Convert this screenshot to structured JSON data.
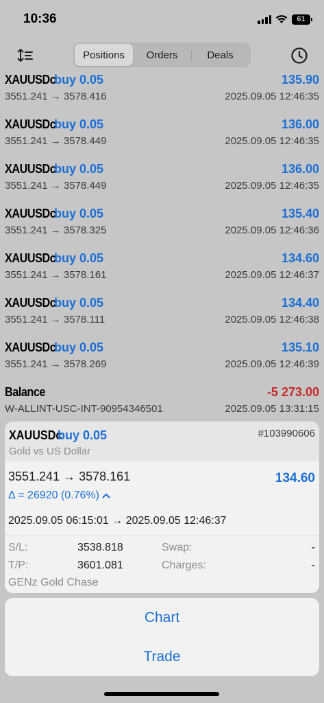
{
  "status": {
    "time": "10:36",
    "battery": "61"
  },
  "tabs": [
    "Positions",
    "Orders",
    "Deals"
  ],
  "active_tab": 0,
  "positions": [
    {
      "symbol": "XAUUSDc",
      "type": "buy 0.05",
      "profit": "135.90",
      "prices": "3551.241 → 3578.416",
      "time": "2025.09.05 12:46:35"
    },
    {
      "symbol": "XAUUSDc",
      "type": "buy 0.05",
      "profit": "136.00",
      "prices": "3551.241 → 3578.449",
      "time": "2025.09.05 12:46:35"
    },
    {
      "symbol": "XAUUSDc",
      "type": "buy 0.05",
      "profit": "136.00",
      "prices": "3551.241 → 3578.449",
      "time": "2025.09.05 12:46:35"
    },
    {
      "symbol": "XAUUSDc",
      "type": "buy 0.05",
      "profit": "135.40",
      "prices": "3551.241 → 3578.325",
      "time": "2025.09.05 12:46:36"
    },
    {
      "symbol": "XAUUSDc",
      "type": "buy 0.05",
      "profit": "134.60",
      "prices": "3551.241 → 3578.161",
      "time": "2025.09.05 12:46:37"
    },
    {
      "symbol": "XAUUSDc",
      "type": "buy 0.05",
      "profit": "134.40",
      "prices": "3551.241 → 3578.111",
      "time": "2025.09.05 12:46:38"
    },
    {
      "symbol": "XAUUSDc",
      "type": "buy 0.05",
      "profit": "135.10",
      "prices": "3551.241 → 3578.269",
      "time": "2025.09.05 12:46:39"
    }
  ],
  "balance": {
    "label": "Balance",
    "value": "-5 273.00",
    "account": "W-ALLINT-USC-INT-90954346501",
    "time": "2025.09.05 13:31:15"
  },
  "detail": {
    "symbol": "XAUUSDc",
    "type": "buy 0.05",
    "ticket": "#103990606",
    "description": "Gold vs US Dollar",
    "prices": "3551.241 → 3578.161",
    "profit": "134.60",
    "change": "Δ = 26920 (0.76%)",
    "times": "2025.09.05 06:15:01 → 2025.09.05 12:46:37",
    "sl_label": "S/L:",
    "sl_value": "3538.818",
    "tp_label": "T/P:",
    "tp_value": "3601.081",
    "swap_label": "Swap:",
    "swap_value": "-",
    "charges_label": "Charges:",
    "charges_value": "-",
    "comment": "GENz Gold Chase"
  },
  "actions": {
    "chart": "Chart",
    "trade": "Trade"
  },
  "colors": {
    "accent": "#1b6fd6",
    "negative": "#c62828",
    "dim_bg": "#c6c6c6"
  }
}
